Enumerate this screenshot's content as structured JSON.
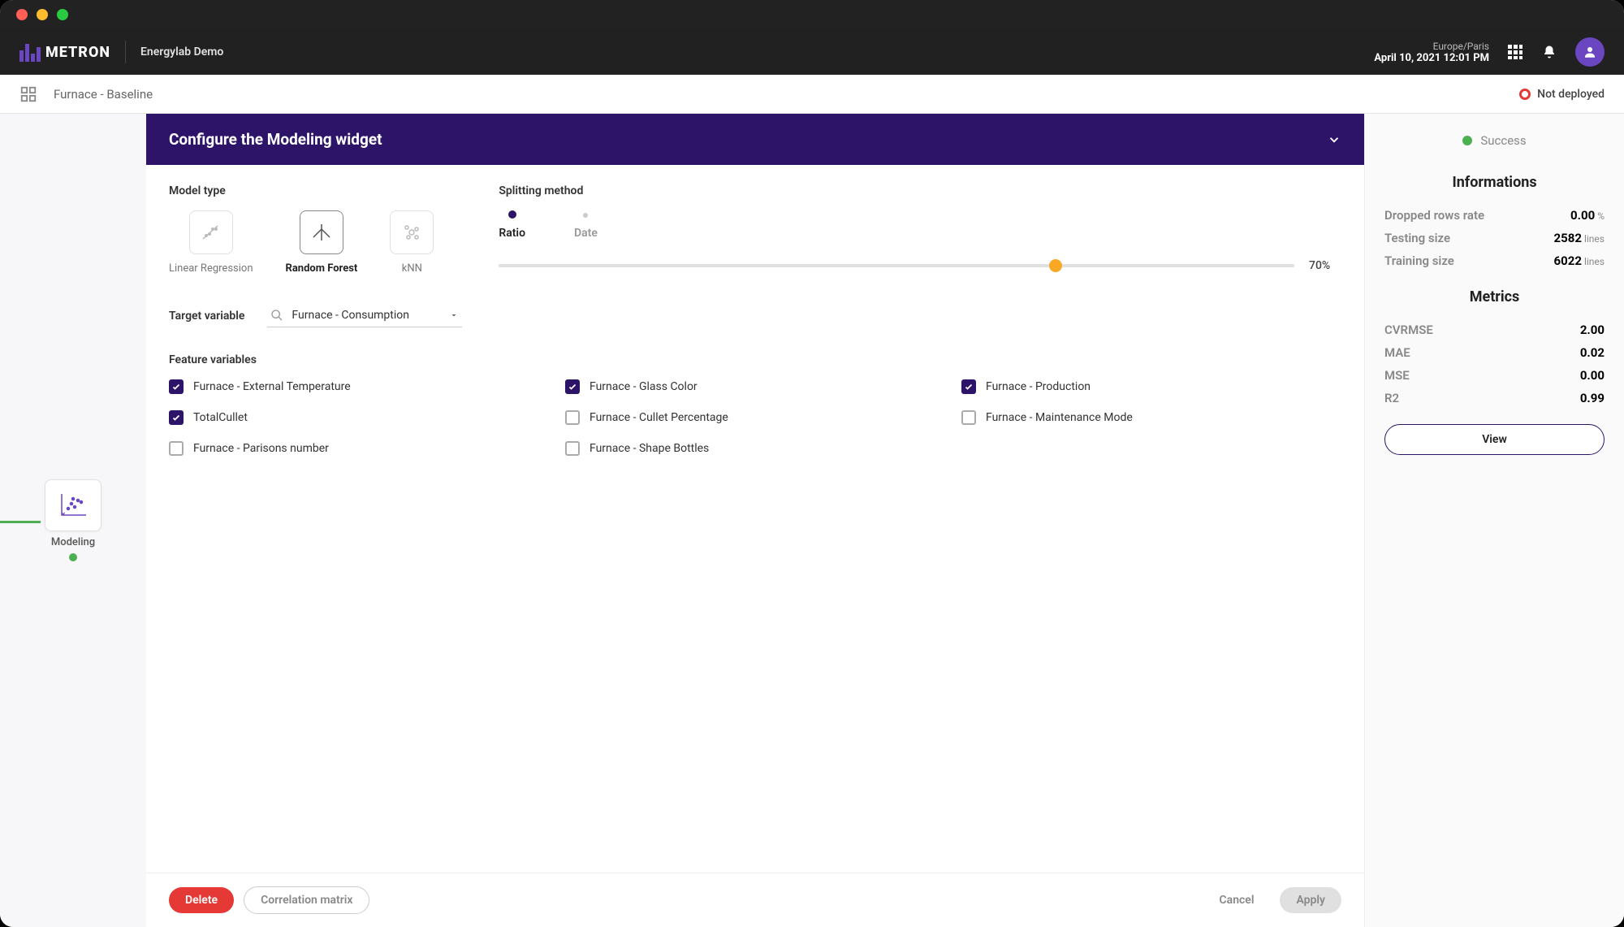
{
  "app": {
    "brand": "METRON",
    "project": "Energylab Demo"
  },
  "datetime": {
    "tz": "Europe/Paris",
    "date": "April 10, 2021 12:01 PM"
  },
  "secondbar": {
    "breadcrumb": "Furnace - Baseline",
    "deploy_status": "Not deployed"
  },
  "node": {
    "label": "Modeling"
  },
  "config": {
    "title": "Configure the Modeling widget",
    "model_type_label": "Model type",
    "splitting_label": "Splitting method",
    "model_types": [
      {
        "label": "Linear Regression"
      },
      {
        "label": "Random Forest"
      },
      {
        "label": "kNN"
      }
    ],
    "split_tabs": {
      "ratio": "Ratio",
      "date": "Date"
    },
    "slider_value": "70%",
    "target_label": "Target variable",
    "target_value": "Furnace - Consumption",
    "features_label": "Feature variables",
    "features": [
      {
        "label": "Furnace - External Temperature",
        "checked": true
      },
      {
        "label": "Furnace - Glass Color",
        "checked": true
      },
      {
        "label": "Furnace - Production",
        "checked": true
      },
      {
        "label": "TotalCullet",
        "checked": true
      },
      {
        "label": "Furnace - Cullet Percentage",
        "checked": false
      },
      {
        "label": "Furnace - Maintenance Mode",
        "checked": false
      },
      {
        "label": "Furnace - Parisons number",
        "checked": false
      },
      {
        "label": "Furnace - Shape Bottles",
        "checked": false
      }
    ]
  },
  "footer": {
    "delete": "Delete",
    "corr": "Correlation matrix",
    "cancel": "Cancel",
    "apply": "Apply"
  },
  "panel": {
    "success": "Success",
    "info_title": "Informations",
    "metrics_title": "Metrics",
    "info": [
      {
        "label": "Dropped rows rate",
        "value": "0.00",
        "unit": "%"
      },
      {
        "label": "Testing size",
        "value": "2582",
        "unit": "lines"
      },
      {
        "label": "Training size",
        "value": "6022",
        "unit": "lines"
      }
    ],
    "metrics": [
      {
        "label": "CVRMSE",
        "value": "2.00"
      },
      {
        "label": "MAE",
        "value": "0.02"
      },
      {
        "label": "MSE",
        "value": "0.00"
      },
      {
        "label": "R2",
        "value": "0.99"
      }
    ],
    "view": "View"
  }
}
